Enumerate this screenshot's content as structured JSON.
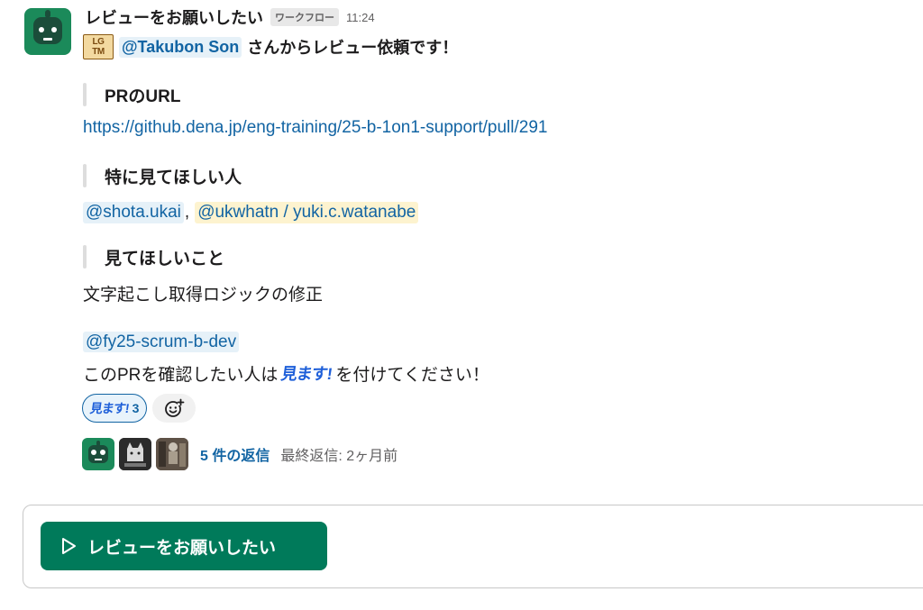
{
  "message": {
    "sender": "レビューをお願いしたい",
    "badge": "ワークフロー",
    "time": "11:24",
    "lgtm_line1": "LG",
    "lgtm_line2": "TM",
    "requester_mention": "@Takubon Son",
    "request_text": "さんからレビュー依頼です！",
    "sections": {
      "pr_url_title": "PRのURL",
      "pr_url": "https://github.dena.jp/eng-training/25-b-1on1-support/pull/291",
      "reviewers_title": "特に見てほしい人",
      "reviewer1": "@shota.ukai",
      "reviewer_sep": ",",
      "reviewer2": "@ukwhatn / yuki.c.watanabe",
      "focus_title": "見てほしいこと",
      "focus_text": "文字起こし取得ロジックの修正"
    },
    "group_mention": "@fy25-scrum-b-dev",
    "cta_before": "このPRを確認したい人は",
    "cta_emoji_text": "見ます!",
    "cta_after": "を付けてください！"
  },
  "reactions": [
    {
      "emoji_text": "見ます!",
      "count": "3"
    }
  ],
  "thread": {
    "reply_count": "5 件の返信",
    "last_reply": "最終返信: 2ヶ月前"
  },
  "workflow_button": {
    "label": "レビューをお願いしたい"
  },
  "colors": {
    "accent": "#1264a3",
    "workflow_green": "#007a5a",
    "avatar_green": "#1b8a5a"
  }
}
